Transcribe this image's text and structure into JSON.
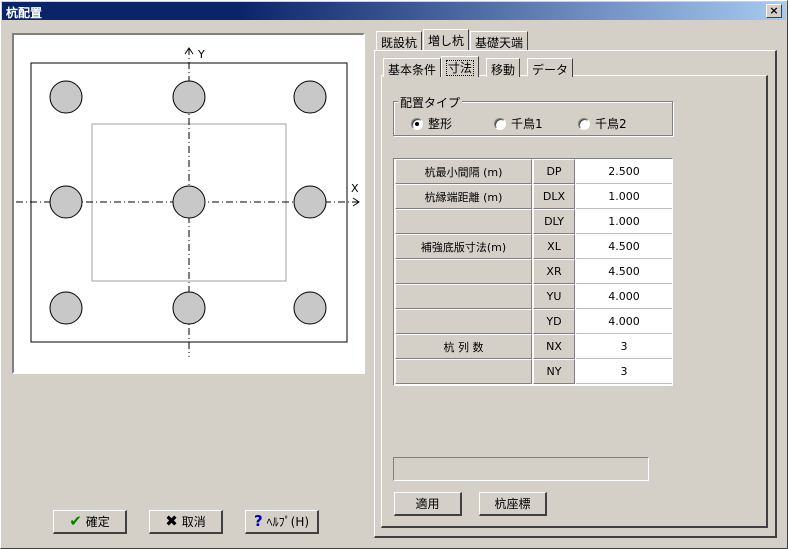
{
  "window": {
    "title": "杭配置",
    "close_label": "×"
  },
  "drawing": {
    "axis_x_label": "X",
    "axis_y_label": "Y"
  },
  "buttons": {
    "ok": "確定",
    "cancel": "取消",
    "help": "ﾍﾙﾌﾟ(H)",
    "apply": "適用",
    "pile_coords": "杭座標"
  },
  "outer_tabs": [
    "既設杭",
    "増し杭",
    "基礎天端"
  ],
  "inner_tabs": [
    "基本条件",
    "寸法",
    "移動",
    "データ"
  ],
  "layout_type": {
    "title": "配置タイプ",
    "options": [
      "整形",
      "千鳥1",
      "千鳥2"
    ],
    "selected": "整形"
  },
  "grid": {
    "rows": [
      {
        "name": "杭最小間隔 (m)",
        "code": "DP",
        "value": "2.500"
      },
      {
        "name": "杭縁端距離 (m)",
        "code": "DLX",
        "value": "1.000"
      },
      {
        "name": "",
        "code": "DLY",
        "value": "1.000"
      },
      {
        "name": "補強底版寸法(m)",
        "code": "XL",
        "value": "4.500"
      },
      {
        "name": "",
        "code": "XR",
        "value": "4.500"
      },
      {
        "name": "",
        "code": "YU",
        "value": "4.000"
      },
      {
        "name": "",
        "code": "YD",
        "value": "4.000"
      },
      {
        "name": "杭 列 数",
        "code": "NX",
        "value": "3"
      },
      {
        "name": "",
        "code": "NY",
        "value": "3"
      }
    ]
  },
  "status_field": {
    "value": ""
  },
  "colors": {
    "titlebar_start": "#0a246a",
    "titlebar_end": "#a6caf0",
    "pile_fill": "#c8c8c8",
    "face": "#d4d0c8"
  }
}
